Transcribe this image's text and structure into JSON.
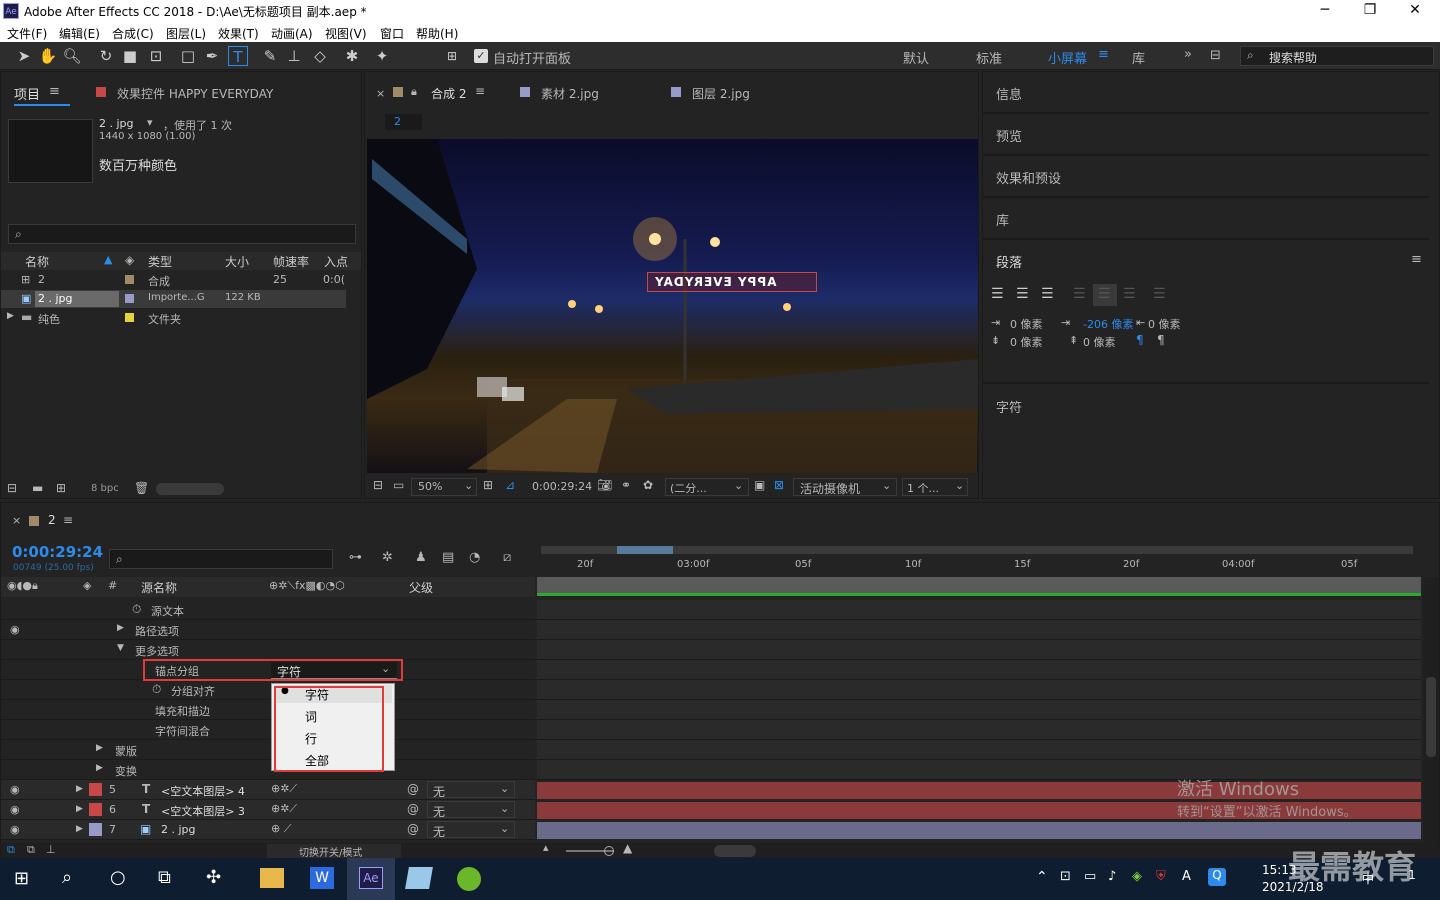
{
  "titlebar": {
    "title": "Adobe After Effects CC 2018 - D:\\Ae\\无标题项目 副本.aep *",
    "minimize": "─",
    "maximize": "❐",
    "close": "✕",
    "app_icon": "Ae"
  },
  "menu": [
    "文件(F)",
    "编辑(E)",
    "合成(C)",
    "图层(L)",
    "效果(T)",
    "动画(A)",
    "视图(V)",
    "窗口",
    "帮助(H)"
  ],
  "toolbar": {
    "auto_open": "自动打开面板",
    "workspaces": [
      "默认",
      "标准",
      "小屏幕",
      "库"
    ],
    "active_workspace": "小屏幕",
    "search_placeholder": "搜索帮助",
    "overflow": "»"
  },
  "project": {
    "tab": "项目",
    "effects_tab": "效果控件 HAPPY EVERYDAY",
    "file_name": "2 . jpg",
    "used": "，使用了 1 次",
    "dims": "1440 x 1080 (1.00)",
    "colors": "数百万种颜色",
    "columns": [
      "名称",
      "类型",
      "大小",
      "帧速率",
      "入点"
    ],
    "rows": [
      {
        "name": "2",
        "type": "合成",
        "size": "",
        "fps": "25",
        "in": "0:0(",
        "color": "#a08a6a"
      },
      {
        "name": "2 . jpg",
        "type": "Importe...G",
        "size": "122 KB",
        "fps": "",
        "in": "",
        "color": "#9a9ac8"
      },
      {
        "name": "纯色",
        "type": "文件夹",
        "size": "",
        "fps": "",
        "in": "",
        "color": "#e6d23a"
      }
    ],
    "bpc": "8 bpc"
  },
  "viewer": {
    "tabs": [
      "合成 2",
      "素材 2.jpg",
      "图层 2.jpg"
    ],
    "comp_name": "2",
    "overlay_text": "APPY EVERYDAY",
    "zoom": "50%",
    "timecode": "0:00:29:24",
    "resolution": "(二分...",
    "camera": "活动摄像机",
    "views": "1 个..."
  },
  "right_panels": {
    "items": [
      "信息",
      "预览",
      "效果和预设",
      "库",
      "段落",
      "字符"
    ],
    "para_values": {
      "indent_left": "0 像素",
      "indent_first": "-206 像素",
      "indent_right": "0 像素",
      "space_before": "0 像素",
      "space_after": "0 像素"
    }
  },
  "timeline": {
    "tab": "2",
    "timecode": "0:00:29:24",
    "frames": "00749 (25.00 fps)",
    "col_source": "源名称",
    "col_parent": "父级",
    "hash": "#",
    "ruler": [
      "20f",
      "03:00f",
      "05f",
      "10f",
      "15f",
      "20f",
      "04:00f",
      "05f"
    ],
    "props": [
      {
        "label": "源文本",
        "indent": 1
      },
      {
        "label": "路径选项",
        "indent": 1,
        "arrow": "▶"
      },
      {
        "label": "更多选项",
        "indent": 1,
        "arrow": "▼"
      },
      {
        "label": "锚点分组",
        "indent": 2
      },
      {
        "label": "分组对齐",
        "indent": 2
      },
      {
        "label": "填充和描边",
        "indent": 2
      },
      {
        "label": "字符间混合",
        "indent": 2
      },
      {
        "label": "蒙版",
        "indent": 0,
        "arrow": "▶"
      },
      {
        "label": "变换",
        "indent": 0,
        "arrow": "▶"
      }
    ],
    "anchor_value": "字符",
    "dropdown": [
      "字符",
      "词",
      "行",
      "全部"
    ],
    "layers": [
      {
        "num": "5",
        "name": "<空文本图层> 4",
        "parent": "无",
        "color": "#c84848"
      },
      {
        "num": "6",
        "name": "<空文本图层> 3",
        "parent": "无",
        "color": "#c84848"
      },
      {
        "num": "7",
        "name": "2 . jpg",
        "parent": "无",
        "color": "#9a9ac8"
      }
    ],
    "switch_mode": "切换开关/模式"
  },
  "watermark": {
    "line1": "激活 Windows",
    "line2": "转到“设置”以激活 Windows。",
    "brand": "最需教育"
  },
  "taskbar": {
    "time": "15:13",
    "date": "2021/2/18",
    "lang": "A",
    "notif": "1"
  }
}
